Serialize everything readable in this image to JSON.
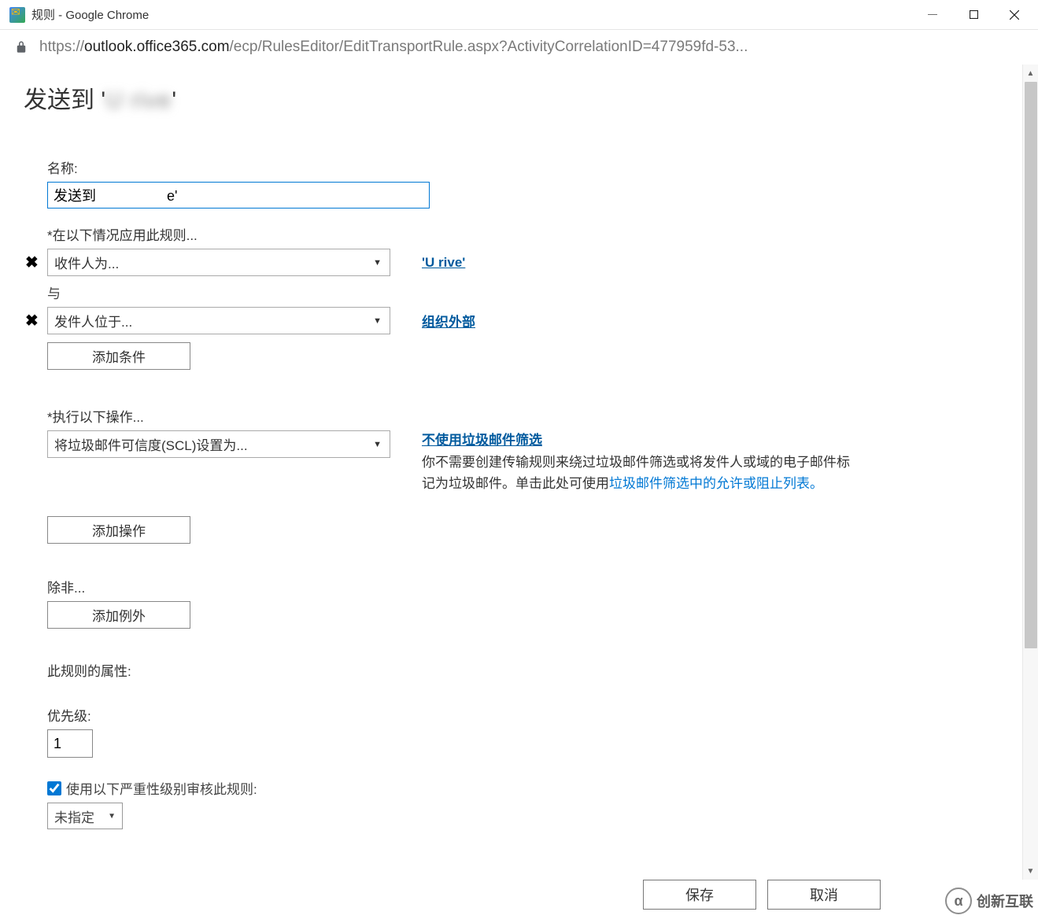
{
  "window": {
    "title": "规则 - Google Chrome"
  },
  "addressbar": {
    "url_host": "outlook.office365.com",
    "url_scheme": "https://",
    "url_path": "/ecp/RulesEditor/EditTransportRule.aspx?ActivityCorrelationID=477959fd-53..."
  },
  "page": {
    "title_prefix": "发送到 '",
    "title_blurred": "U            rive",
    "title_suffix": "'"
  },
  "form": {
    "name_label": "名称:",
    "name_value": "发送到                  e'",
    "apply_rule_label": "*在以下情况应用此规则...",
    "condition1_select": "收件人为...",
    "condition1_value": "'U        rive'",
    "and_label": "与",
    "condition2_select": "发件人位于...",
    "condition2_value": "组织外部",
    "add_condition_btn": "添加条件",
    "do_following_label": "*执行以下操作...",
    "action_select": "将垃圾邮件可信度(SCL)设置为...",
    "action_info_title": "不使用垃圾邮件筛选",
    "action_info_text1": "你不需要创建传输规则来绕过垃圾邮件筛选或将发件人或域的电子邮件标记为垃圾邮件。单击此处可使用",
    "action_info_link": "垃圾邮件筛选中的允许或阻止列表。",
    "add_action_btn": "添加操作",
    "except_label": "除非...",
    "add_exception_btn": "添加例外",
    "props_label": "此规则的属性:",
    "priority_label": "优先级:",
    "priority_value": "1",
    "severity_checkbox_label": "使用以下严重性级别审核此规则:",
    "severity_select": "未指定"
  },
  "footer": {
    "save": "保存",
    "cancel": "取消"
  },
  "watermark": {
    "text": "创新互联"
  }
}
